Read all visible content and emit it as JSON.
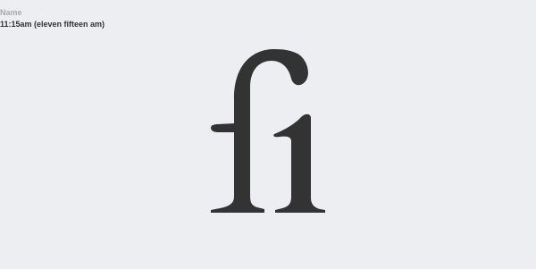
{
  "meta": {
    "label": "Name",
    "value": "11:15am (eleven fifteen am)"
  },
  "glyph": {
    "icon": "fi-ligature-icon",
    "color": "#333333"
  },
  "colors": {
    "background": "#eceef1",
    "label": "#a7abb1",
    "value": "#2f3136"
  }
}
